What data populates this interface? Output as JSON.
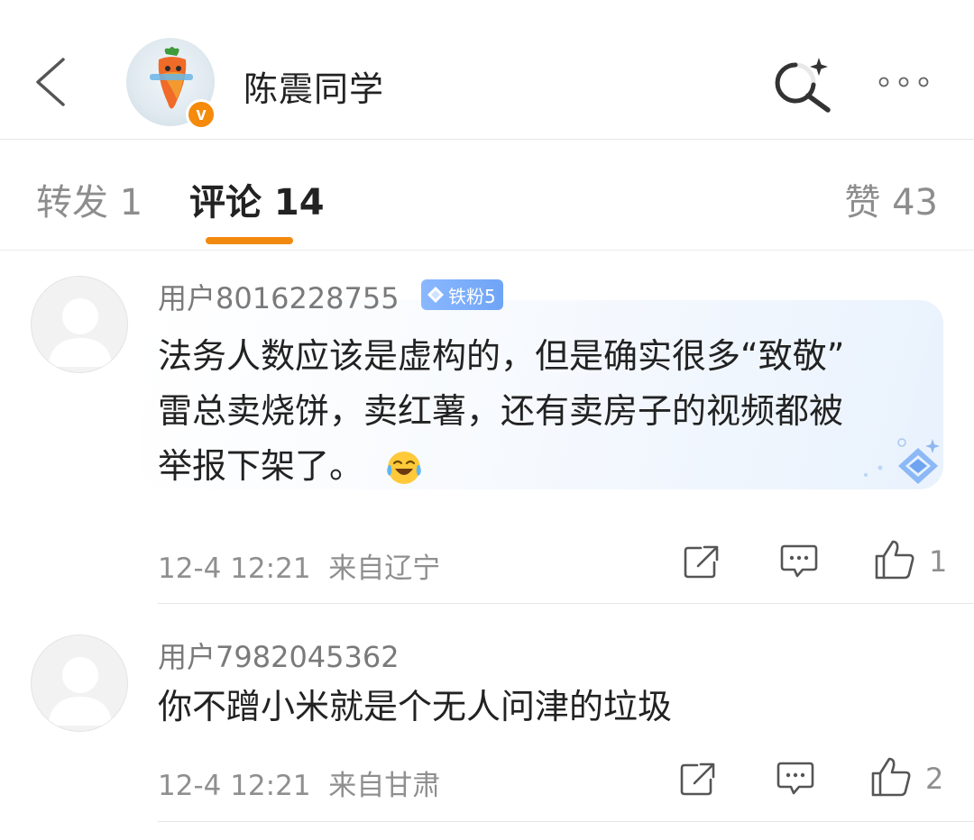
{
  "header": {
    "title": "陈震同学",
    "avatar_badge": "v",
    "back_icon": "chevron-left-icon",
    "search_icon": "search-sparkle-icon",
    "more_icon": "more-dots-icon"
  },
  "tabs": {
    "forward": "转发 1",
    "comment": "评论 14",
    "like": "赞 43"
  },
  "colors": {
    "accent": "#f2890f",
    "verified_badge": "#f58a0b",
    "fan_badge": "#7aaef8"
  },
  "comments": [
    {
      "username": "用户8016228755",
      "fan_badge": "铁粉5",
      "lines": [
        "法务人数应该是虚构的，但是确实很多“致敬”",
        "雷总卖烧饼，卖红薯，还有卖房子的视频都被",
        "举报下架了。"
      ],
      "emoji": "laughing-tears-emoji",
      "time": "12-4 12:21",
      "location": "来自辽宁",
      "likes": "1"
    },
    {
      "username": "用户7982045362",
      "lines": [
        "你不蹭小米就是个无人问津的垃圾"
      ],
      "time": "12-4 12:21",
      "location": "来自甘肃",
      "likes": "2"
    }
  ]
}
